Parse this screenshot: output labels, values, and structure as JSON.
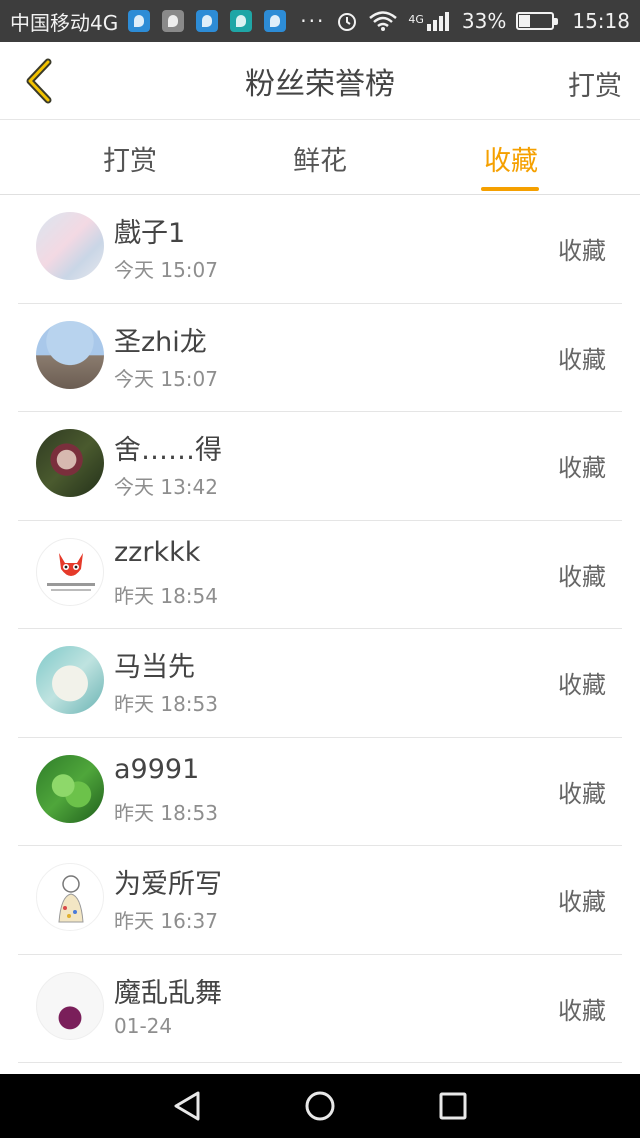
{
  "status_bar": {
    "carrier": "中国移动4G",
    "dots": "···",
    "network": "4G",
    "battery": "33%",
    "battery_level": 0.33,
    "time": "15:18"
  },
  "header": {
    "title": "粉丝荣誉榜",
    "action": "打赏"
  },
  "tabs": [
    {
      "label": "打赏",
      "active": false
    },
    {
      "label": "鲜花",
      "active": false
    },
    {
      "label": "收藏",
      "active": true
    }
  ],
  "list": [
    {
      "name": "戲子1",
      "time": "今天 15:07",
      "action": "收藏"
    },
    {
      "name": "圣zhi龙",
      "time": "今天 15:07",
      "action": "收藏"
    },
    {
      "name": "舍……得",
      "time": "今天 13:42",
      "action": "收藏"
    },
    {
      "name": "zzrkkk",
      "time": "昨天 18:54",
      "action": "收藏"
    },
    {
      "name": "马当先",
      "time": "昨天 18:53",
      "action": "收藏"
    },
    {
      "name": "a9991",
      "time": "昨天 18:53",
      "action": "收藏"
    },
    {
      "name": "为爱所写",
      "time": "昨天 16:37",
      "action": "收藏"
    },
    {
      "name": "魔乱乱舞",
      "time": "01-24",
      "action": "收藏"
    }
  ],
  "colors": {
    "accent": "#f5a000",
    "status_bar": "#3d3d3d",
    "nav_bar": "#000000"
  },
  "icons": {
    "back": "chevron-left-icon",
    "alarm": "alarm-icon",
    "wifi": "wifi-icon",
    "signal": "signal-icon",
    "battery": "battery-icon",
    "nav_back": "triangle-back-icon",
    "nav_home": "circle-home-icon",
    "nav_recent": "square-recent-icon"
  }
}
